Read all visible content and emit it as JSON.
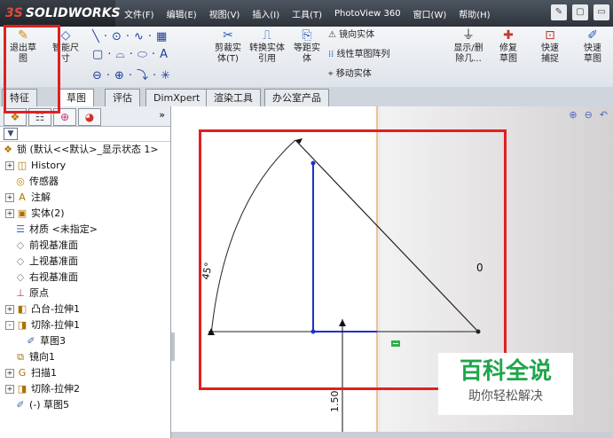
{
  "app": {
    "logo_ds": "3S",
    "logo_text": "SOLIDWORKS"
  },
  "menu": [
    "文件(F)",
    "编辑(E)",
    "视图(V)",
    "插入(I)",
    "工具(T)",
    "PhotoView 360",
    "窗口(W)",
    "帮助(H)"
  ],
  "ribbon": {
    "exit_sketch": "退出草图",
    "smart_dim": "智能尺寸",
    "trim": "剪裁实体(T)",
    "convert": "转换实体引用",
    "offset": "等距实体",
    "mirror": "镜向实体",
    "linear_pattern": "线性草图阵列",
    "move": "移动实体",
    "show_delete": "显示/删除几...",
    "repair": "修复草图",
    "quick_snap": "快速捕捉",
    "quick_sketch": "快速草图"
  },
  "tabs": [
    "特征",
    "草图",
    "评估",
    "DimXpert",
    "渲染工具",
    "办公室产品"
  ],
  "active_tab": "草图",
  "tree": {
    "root": "锁 (默认<<默认>_显示状态 1>",
    "items": [
      {
        "label": "History",
        "icon": "history-icon",
        "pm": "+"
      },
      {
        "label": "传感器",
        "icon": "sensor-icon",
        "pm": ""
      },
      {
        "label": "注解",
        "icon": "annotation-icon",
        "pm": "+"
      },
      {
        "label": "实体(2)",
        "icon": "solid-body-icon",
        "pm": "+"
      },
      {
        "label": "材质 <未指定>",
        "icon": "material-icon",
        "pm": ""
      },
      {
        "label": "前视基准面",
        "icon": "plane-icon",
        "pm": ""
      },
      {
        "label": "上视基准面",
        "icon": "plane-icon",
        "pm": ""
      },
      {
        "label": "右视基准面",
        "icon": "plane-icon",
        "pm": ""
      },
      {
        "label": "原点",
        "icon": "origin-icon",
        "pm": ""
      },
      {
        "label": "凸台-拉伸1",
        "icon": "boss-extrude-icon",
        "pm": "+"
      },
      {
        "label": "切除-拉伸1",
        "icon": "cut-extrude-icon",
        "pm": "-"
      },
      {
        "label": "草图3",
        "icon": "sketch-icon",
        "pm": ""
      },
      {
        "label": "镜向1",
        "icon": "mirror-icon",
        "pm": ""
      },
      {
        "label": "扫描1",
        "icon": "sweep-icon",
        "pm": "+"
      },
      {
        "label": "切除-拉伸2",
        "icon": "cut-extrude-icon",
        "pm": "+"
      },
      {
        "label": "(-) 草图5",
        "icon": "sketch-icon",
        "pm": ""
      }
    ]
  },
  "sketch": {
    "angle_label": "45°",
    "zero_label": "0",
    "dim_label": "1.50"
  },
  "watermark": {
    "line1": "百科全说",
    "line2": "助你轻松解决"
  },
  "colors": {
    "red_highlight": "#e02020",
    "blue_line": "#1f2fd0",
    "green_mark": "#2db24a"
  }
}
